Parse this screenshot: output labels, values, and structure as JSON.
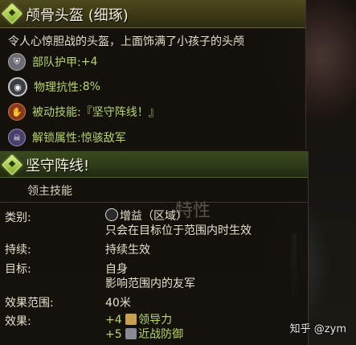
{
  "item": {
    "title": "颅骨头盔 (细琢)",
    "description": "令人心惊胆战的头盔，上面饰满了小孩子的头颅",
    "stats": [
      {
        "icon": "armor-icon",
        "label": "部队护甲: ",
        "value": "+4"
      },
      {
        "icon": "physical-resist-icon",
        "label": "物理抗性: ",
        "value": "8%"
      },
      {
        "icon": "passive-skill-icon",
        "label": "被动技能: ",
        "value": "『坚守阵线！』"
      },
      {
        "icon": "unlock-icon",
        "label": "解锁属性: ",
        "value": "惊骇敌军"
      }
    ]
  },
  "skill": {
    "title": "坚守阵线!",
    "subtitle": "领主技能",
    "ghost": "特性",
    "rows": {
      "type_label": "类别:",
      "type_value": "增益（区域）",
      "type_desc": "只会在目标位于范围内时生效",
      "duration_label": "持续:",
      "duration_value": "持续生效",
      "target_label": "目标:",
      "target_value1": "自身",
      "target_value2": "影响范围内的友军",
      "range_label": "效果范围:",
      "range_value": "40米",
      "effect_label": "效果:",
      "effect1_amount": "+4",
      "effect1_name": "领导力",
      "effect2_amount": "+5",
      "effect2_name": "近战防御"
    }
  },
  "watermark": "知乎 @zym"
}
